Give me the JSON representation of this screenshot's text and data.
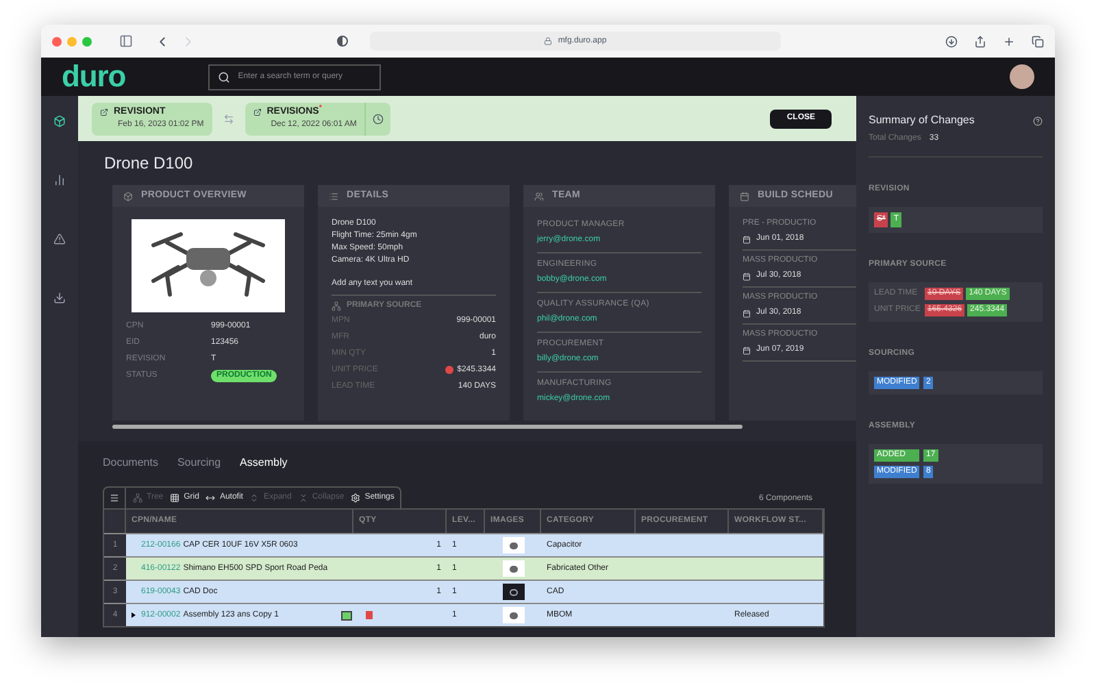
{
  "browser": {
    "url": "mfg.duro.app"
  },
  "header": {
    "logo": "duro",
    "search_placeholder": "Enter a search term or query"
  },
  "sidebar": [
    {
      "selected": true
    },
    {
      "selected": false
    },
    {
      "selected": false
    },
    {
      "selected": false
    }
  ],
  "compare": {
    "revisions": [
      {
        "label": "REVISIONT",
        "date": "Feb 16, 2023 01:02 PM"
      },
      {
        "label": "REVISIONS",
        "date": "Dec 12, 2022 06:01 AM",
        "flag": "*"
      }
    ],
    "close": "CLOSE"
  },
  "title": "Drone D100",
  "overview": {
    "title": "PRODUCT OVERVIEW",
    "fields": [
      {
        "label": "CPN",
        "value": "999-00001"
      },
      {
        "label": "EID",
        "value": "123456"
      },
      {
        "label": "REVISION",
        "value": "T"
      }
    ],
    "status_label": "STATUS",
    "status": "PRODUCTION"
  },
  "details": {
    "title": "DETAILS",
    "lines": [
      "Drone D100",
      "Flight Time: 25min 4gm",
      "Max Speed: 50mph",
      "Camera: 4K Ultra HD"
    ],
    "note": "Add any text you want",
    "source_title": "PRIMARY SOURCE",
    "fields": [
      {
        "label": "MPN",
        "value": "999-00001",
        "alert": false
      },
      {
        "label": "MFR",
        "value": "duro",
        "alert": false
      },
      {
        "label": "MIN QTY",
        "value": "1",
        "alert": false
      },
      {
        "label": "UNIT PRICE",
        "value": "$245.3344",
        "alert": true
      },
      {
        "label": "LEAD TIME",
        "value": "140 DAYS",
        "alert": false
      }
    ]
  },
  "team": {
    "title": "TEAM",
    "members": [
      {
        "role": "PRODUCT MANAGER",
        "email": "jerry@drone.com"
      },
      {
        "role": "ENGINEERING",
        "email": "bobby@drone.com"
      },
      {
        "role": "QUALITY ASSURANCE (QA)",
        "email": "phil@drone.com"
      },
      {
        "role": "PROCUREMENT",
        "email": "billy@drone.com"
      },
      {
        "role": "MANUFACTURING",
        "email": "mickey@drone.com"
      }
    ]
  },
  "schedule": {
    "title": "BUILD SCHEDU",
    "items": [
      {
        "label": "PRE - PRODUCTIO",
        "date": "Jun 01, 2018"
      },
      {
        "label": "MASS PRODUCTIO",
        "date": "Jul 30, 2018"
      },
      {
        "label": "MASS PRODUCTIO",
        "date": "Jul 30, 2018"
      },
      {
        "label": "MASS PRODUCTIO",
        "date": "Jun 07, 2019"
      }
    ]
  },
  "tabs": [
    {
      "label": "Documents",
      "selected": false
    },
    {
      "label": "Sourcing",
      "selected": false
    },
    {
      "label": "Assembly",
      "selected": true
    }
  ],
  "toolbar": [
    {
      "kind": "tree",
      "label": "Tree",
      "disabled": true
    },
    {
      "kind": "grid",
      "label": "Grid",
      "disabled": false
    },
    {
      "kind": "autofit",
      "label": "Autofit",
      "disabled": false
    },
    {
      "kind": "expand",
      "label": "Expand",
      "disabled": true
    },
    {
      "kind": "collapse",
      "label": "Collapse",
      "disabled": true
    },
    {
      "kind": "settings",
      "label": "Settings",
      "disabled": false
    }
  ],
  "component_count": "6 Components",
  "table": {
    "columns": [
      "CPN/NAME",
      "QTY",
      "LEV...",
      "IMAGES",
      "CATEGORY",
      "PROCUREMENT",
      "WORKFLOW ST..."
    ],
    "rows": [
      {
        "number": "1",
        "cpn": "212-00166",
        "name": "CAP CER 10UF 16V X5R 0603",
        "qty": "1",
        "level": "1",
        "kind": "light",
        "category": "Capacitor",
        "color": "#cfe1f7",
        "expandable": false
      },
      {
        "number": "2",
        "cpn": "416-00122",
        "name": "Shimano EH500 SPD Sport Road Peda",
        "qty": "1",
        "level": "1",
        "kind": "light",
        "category": "Fabricated Other",
        "color": "#d4ebcc",
        "expandable": false
      },
      {
        "number": "3",
        "cpn": "619-00043",
        "name": "CAD Doc",
        "qty": "1",
        "level": "1",
        "kind": "dark",
        "category": "CAD",
        "color": "#cfe1f7",
        "expandable": false
      },
      {
        "number": "4",
        "cpn": "912-00002",
        "name": "Assembly 123 ans Copy 1",
        "level": "1",
        "kind": "light",
        "category": "MBOM",
        "workflow": "Released",
        "color": "#cfe1f7",
        "expandable": true
      }
    ]
  },
  "summary": {
    "title": "Summary of Changes",
    "total_label": "Total Changes",
    "total": "33",
    "revision_title": "REVISION",
    "revision": [
      {
        "text": "S*",
        "kind": "removed"
      },
      {
        "text": "T",
        "kind": "added"
      }
    ],
    "source_title": "PRIMARY SOURCE",
    "source": [
      {
        "label": "LEAD TIME",
        "old": "10 DAYS",
        "new": "140 DAYS"
      },
      {
        "label": "UNIT PRICE",
        "old": "165.4326",
        "new": "245.3344"
      }
    ],
    "sourcing_title": "SOURCING",
    "sourcing": [
      {
        "label": "MODIFIED",
        "count": "2",
        "kind": "modified"
      }
    ],
    "assembly_title": "ASSEMBLY",
    "assembly": [
      {
        "label": "ADDED",
        "count": "17",
        "kind": "added"
      },
      {
        "label": "MODIFIED",
        "count": "8",
        "kind": "modified"
      }
    ]
  }
}
